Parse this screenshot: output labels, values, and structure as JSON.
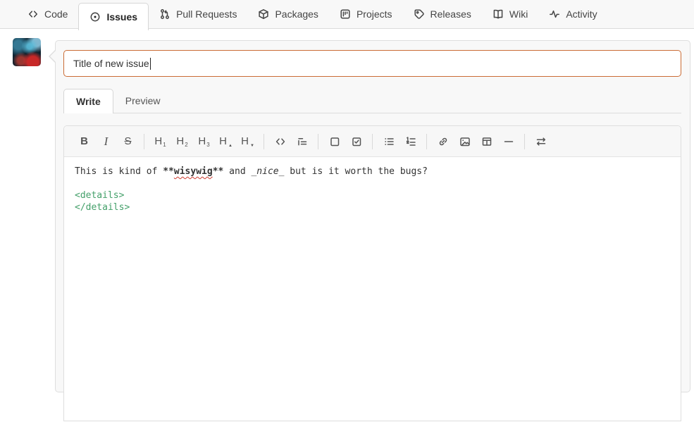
{
  "nav": {
    "items": [
      {
        "label": "Code",
        "icon": "code-icon",
        "active": false
      },
      {
        "label": "Issues",
        "icon": "issue-opened-icon",
        "active": true
      },
      {
        "label": "Pull Requests",
        "icon": "git-pull-request-icon",
        "active": false
      },
      {
        "label": "Packages",
        "icon": "package-icon",
        "active": false
      },
      {
        "label": "Projects",
        "icon": "project-icon",
        "active": false
      },
      {
        "label": "Releases",
        "icon": "tag-icon",
        "active": false
      },
      {
        "label": "Wiki",
        "icon": "book-icon",
        "active": false
      },
      {
        "label": "Activity",
        "icon": "pulse-icon",
        "active": false
      }
    ]
  },
  "issue_form": {
    "title_input": {
      "value": "Title of new issue",
      "placeholder": ""
    },
    "tabs": {
      "write": "Write",
      "preview": "Preview",
      "active": "Write"
    },
    "toolbar": {
      "glyphs": {
        "bold": "B",
        "italic": "I",
        "strikethrough": "S",
        "heading": "H",
        "h1_sub": "1",
        "h2_sub": "2",
        "h3_sub": "3",
        "heading_up_sub": "▲",
        "heading_down_sub": "▼"
      },
      "icons": [
        "bold",
        "italic",
        "strikethrough",
        "heading-1",
        "heading-2",
        "heading-3",
        "heading-up",
        "heading-down",
        "code",
        "quote",
        "box",
        "checkbox",
        "unordered-list",
        "ordered-list",
        "link",
        "image",
        "table",
        "horizontal-rule",
        "switch-editor"
      ]
    },
    "editor": {
      "line1": [
        {
          "text": "This is kind of ",
          "style": "normal"
        },
        {
          "text": "**",
          "style": "bold"
        },
        {
          "text": "wisywig",
          "style": "bold-misspelled"
        },
        {
          "text": "**",
          "style": "bold"
        },
        {
          "text": " and ",
          "style": "normal"
        },
        {
          "text": "_nice_",
          "style": "italic"
        },
        {
          "text": " but is it worth the bugs?",
          "style": "normal"
        }
      ],
      "line2": "",
      "line3": "<details>",
      "line4": "</details>"
    }
  },
  "colors": {
    "accent_orange": "#ca6c35",
    "html_tag_green": "#44a06a",
    "spellcheck_red": "#cc3b2f",
    "nav_background": "#f8f8f8",
    "toolbar_icon": "#555555"
  }
}
